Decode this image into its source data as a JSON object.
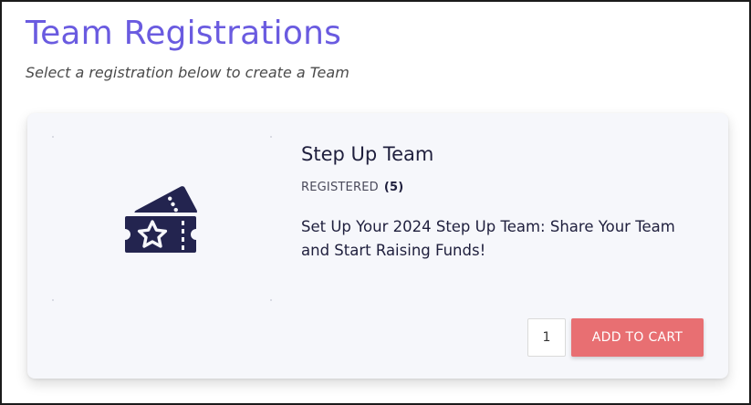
{
  "header": {
    "title": "Team Registrations",
    "subtitle": "Select a registration below to create a Team"
  },
  "product": {
    "name": "Step Up Team",
    "registered_label": "REGISTERED",
    "registered_count": "(5)",
    "description": "Set Up Your 2024 Step Up Team: Share Your Team and Start Raising Funds!",
    "image_icon": "ticket-star-icon",
    "quantity": "1",
    "add_to_cart_label": "ADD TO CART"
  },
  "colors": {
    "title": "#6a5be0",
    "icon": "#23244f",
    "button": "#e86f72",
    "card_background": "#f6f7fb"
  }
}
